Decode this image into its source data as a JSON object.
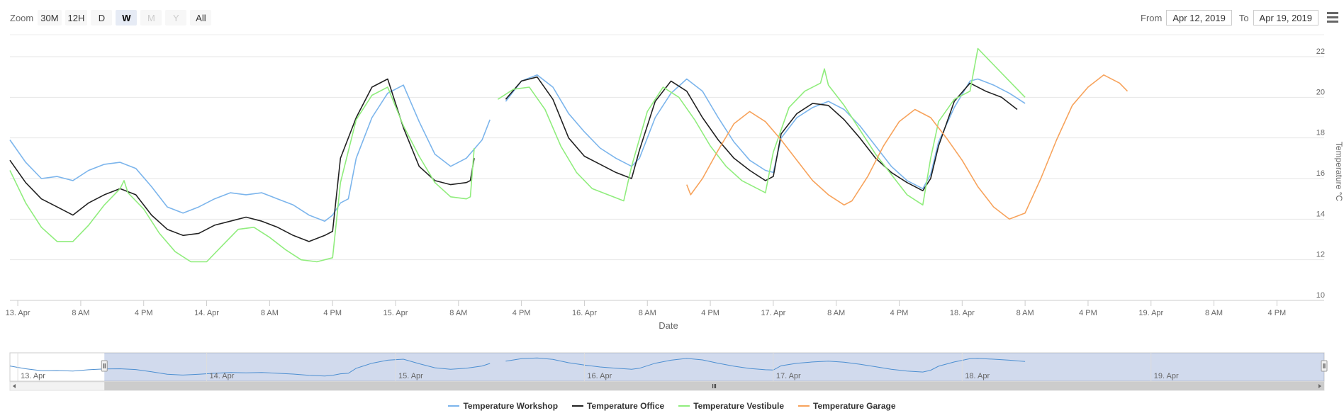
{
  "toolbar": {
    "zoom_label": "Zoom",
    "buttons": [
      {
        "label": "30M",
        "state": "normal"
      },
      {
        "label": "12H",
        "state": "normal"
      },
      {
        "label": "D",
        "state": "normal"
      },
      {
        "label": "W",
        "state": "selected"
      },
      {
        "label": "M",
        "state": "disabled"
      },
      {
        "label": "Y",
        "state": "disabled"
      },
      {
        "label": "All",
        "state": "normal"
      }
    ],
    "from_label": "From",
    "from_value": "Apr 12, 2019",
    "to_label": "To",
    "to_value": "Apr 19, 2019"
  },
  "menu_icon": "hamburger-menu-icon",
  "chart_data": {
    "type": "line",
    "xlabel": "Date",
    "ylabel": "Temperature °C",
    "ylim": [
      10,
      22
    ],
    "y_ticks": [
      "10",
      "12",
      "14",
      "16",
      "18",
      "20",
      "22"
    ],
    "x_ticks": [
      "13. Apr",
      "8 AM",
      "4 PM",
      "14. Apr",
      "8 AM",
      "4 PM",
      "15. Apr",
      "8 AM",
      "4 PM",
      "16. Apr",
      "8 AM",
      "4 PM",
      "17. Apr",
      "8 AM",
      "4 PM",
      "18. Apr",
      "8 AM",
      "4 PM",
      "19. Apr",
      "8 AM",
      "4 PM"
    ],
    "x_tick_hours": [
      24,
      32,
      40,
      48,
      56,
      64,
      72,
      80,
      88,
      96,
      104,
      112,
      120,
      128,
      136,
      144,
      152,
      160,
      168,
      176,
      184
    ],
    "x_range_hours": [
      23,
      190
    ],
    "grid": "horizontal",
    "legend_position": "bottom-center",
    "series": [
      {
        "name": "Temperature Workshop",
        "color": "#7cb5ec",
        "points": [
          [
            23,
            17.9
          ],
          [
            25,
            16.8
          ],
          [
            27,
            16.0
          ],
          [
            29,
            16.1
          ],
          [
            31,
            15.9
          ],
          [
            33,
            16.4
          ],
          [
            35,
            16.7
          ],
          [
            37,
            16.8
          ],
          [
            39,
            16.5
          ],
          [
            41,
            15.6
          ],
          [
            43,
            14.6
          ],
          [
            45,
            14.3
          ],
          [
            47,
            14.6
          ],
          [
            49,
            15.0
          ],
          [
            51,
            15.3
          ],
          [
            53,
            15.2
          ],
          [
            55,
            15.3
          ],
          [
            57,
            15.0
          ],
          [
            59,
            14.7
          ],
          [
            61,
            14.2
          ],
          [
            63,
            13.9
          ],
          [
            64,
            14.2
          ],
          [
            65,
            14.8
          ],
          [
            66,
            15.0
          ],
          [
            67,
            17.0
          ],
          [
            69,
            19.0
          ],
          [
            71,
            20.2
          ],
          [
            73,
            20.6
          ],
          [
            75,
            18.8
          ],
          [
            77,
            17.2
          ],
          [
            79,
            16.6
          ],
          [
            81,
            17.0
          ],
          [
            83,
            17.9
          ],
          [
            84,
            18.9
          ],
          [
            85,
            null
          ],
          [
            86,
            19.8
          ],
          [
            88,
            20.8
          ],
          [
            90,
            21.1
          ],
          [
            92,
            20.5
          ],
          [
            94,
            19.2
          ],
          [
            96,
            18.3
          ],
          [
            98,
            17.5
          ],
          [
            100,
            17.0
          ],
          [
            102,
            16.6
          ],
          [
            103,
            17.0
          ],
          [
            105,
            19.0
          ],
          [
            107,
            20.2
          ],
          [
            109,
            20.9
          ],
          [
            111,
            20.3
          ],
          [
            113,
            19.0
          ],
          [
            115,
            17.8
          ],
          [
            117,
            16.9
          ],
          [
            119,
            16.4
          ],
          [
            120,
            16.3
          ],
          [
            121,
            18.0
          ],
          [
            123,
            19.0
          ],
          [
            125,
            19.5
          ],
          [
            127,
            19.8
          ],
          [
            129,
            19.4
          ],
          [
            131,
            18.6
          ],
          [
            133,
            17.6
          ],
          [
            135,
            16.6
          ],
          [
            137,
            15.9
          ],
          [
            139,
            15.5
          ],
          [
            140,
            16.2
          ],
          [
            141,
            17.8
          ],
          [
            143,
            19.5
          ],
          [
            145,
            20.8
          ],
          [
            146,
            20.9
          ],
          [
            148,
            20.6
          ],
          [
            150,
            20.2
          ],
          [
            152,
            19.7
          ]
        ]
      },
      {
        "name": "Temperature Office",
        "color": "#222222",
        "points": [
          [
            23,
            16.9
          ],
          [
            25,
            15.8
          ],
          [
            27,
            15.0
          ],
          [
            29,
            14.6
          ],
          [
            31,
            14.2
          ],
          [
            33,
            14.8
          ],
          [
            35,
            15.2
          ],
          [
            37,
            15.5
          ],
          [
            39,
            15.2
          ],
          [
            41,
            14.2
          ],
          [
            43,
            13.5
          ],
          [
            45,
            13.2
          ],
          [
            47,
            13.3
          ],
          [
            49,
            13.7
          ],
          [
            51,
            13.9
          ],
          [
            53,
            14.1
          ],
          [
            55,
            13.9
          ],
          [
            57,
            13.6
          ],
          [
            59,
            13.2
          ],
          [
            61,
            12.9
          ],
          [
            63,
            13.2
          ],
          [
            64,
            13.4
          ],
          [
            65,
            17.0
          ],
          [
            67,
            19.0
          ],
          [
            69,
            20.5
          ],
          [
            71,
            20.9
          ],
          [
            73,
            18.5
          ],
          [
            75,
            16.6
          ],
          [
            77,
            15.9
          ],
          [
            79,
            15.7
          ],
          [
            81,
            15.8
          ],
          [
            81.5,
            15.9
          ],
          [
            82,
            17.0
          ],
          [
            83,
            null
          ],
          [
            86,
            19.9
          ],
          [
            88,
            20.8
          ],
          [
            90,
            21.0
          ],
          [
            92,
            19.9
          ],
          [
            94,
            18.0
          ],
          [
            96,
            17.1
          ],
          [
            98,
            16.7
          ],
          [
            100,
            16.3
          ],
          [
            102,
            16.0
          ],
          [
            103,
            17.4
          ],
          [
            105,
            19.8
          ],
          [
            107,
            20.8
          ],
          [
            109,
            20.3
          ],
          [
            111,
            19.0
          ],
          [
            113,
            17.9
          ],
          [
            115,
            17.0
          ],
          [
            117,
            16.4
          ],
          [
            119,
            15.9
          ],
          [
            120,
            16.1
          ],
          [
            121,
            18.2
          ],
          [
            123,
            19.2
          ],
          [
            125,
            19.7
          ],
          [
            127,
            19.6
          ],
          [
            129,
            18.9
          ],
          [
            131,
            18.0
          ],
          [
            133,
            17.0
          ],
          [
            135,
            16.3
          ],
          [
            137,
            15.8
          ],
          [
            139,
            15.4
          ],
          [
            140,
            16.0
          ],
          [
            141,
            17.6
          ],
          [
            143,
            19.8
          ],
          [
            145,
            20.7
          ],
          [
            147,
            20.3
          ],
          [
            149,
            20.0
          ],
          [
            151,
            19.4
          ]
        ]
      },
      {
        "name": "Temperature Vestibule",
        "color": "#90ed7d",
        "points": [
          [
            23,
            16.4
          ],
          [
            25,
            14.8
          ],
          [
            27,
            13.6
          ],
          [
            29,
            12.9
          ],
          [
            31,
            12.9
          ],
          [
            33,
            13.7
          ],
          [
            35,
            14.7
          ],
          [
            37,
            15.5
          ],
          [
            37.5,
            15.9
          ],
          [
            38,
            15.3
          ],
          [
            40,
            14.5
          ],
          [
            42,
            13.3
          ],
          [
            44,
            12.4
          ],
          [
            46,
            11.9
          ],
          [
            48,
            11.9
          ],
          [
            50,
            12.7
          ],
          [
            52,
            13.5
          ],
          [
            54,
            13.6
          ],
          [
            56,
            13.1
          ],
          [
            58,
            12.5
          ],
          [
            60,
            12.0
          ],
          [
            62,
            11.9
          ],
          [
            64,
            12.1
          ],
          [
            65,
            15.8
          ],
          [
            67,
            18.9
          ],
          [
            69,
            20.1
          ],
          [
            71,
            20.5
          ],
          [
            73,
            18.6
          ],
          [
            75,
            17.1
          ],
          [
            77,
            15.8
          ],
          [
            79,
            15.1
          ],
          [
            81,
            15.0
          ],
          [
            81.5,
            15.1
          ],
          [
            82,
            17.5
          ],
          [
            83,
            null
          ],
          [
            85,
            19.9
          ],
          [
            87,
            20.4
          ],
          [
            89,
            20.5
          ],
          [
            91,
            19.4
          ],
          [
            93,
            17.6
          ],
          [
            95,
            16.3
          ],
          [
            97,
            15.5
          ],
          [
            99,
            15.2
          ],
          [
            101,
            14.9
          ],
          [
            102,
            16.6
          ],
          [
            104,
            19.3
          ],
          [
            106,
            20.5
          ],
          [
            108,
            20.0
          ],
          [
            110,
            18.9
          ],
          [
            112,
            17.6
          ],
          [
            114,
            16.6
          ],
          [
            116,
            15.9
          ],
          [
            118,
            15.5
          ],
          [
            119,
            15.3
          ],
          [
            120,
            17.3
          ],
          [
            122,
            19.5
          ],
          [
            124,
            20.3
          ],
          [
            126,
            20.7
          ],
          [
            126.5,
            21.4
          ],
          [
            127,
            20.6
          ],
          [
            129,
            19.6
          ],
          [
            131,
            18.4
          ],
          [
            133,
            17.2
          ],
          [
            135,
            16.2
          ],
          [
            137,
            15.2
          ],
          [
            139,
            14.7
          ],
          [
            140,
            17.0
          ],
          [
            141,
            18.8
          ],
          [
            143,
            19.9
          ],
          [
            145,
            20.3
          ],
          [
            146,
            22.4
          ],
          [
            148,
            21.6
          ],
          [
            150,
            20.8
          ],
          [
            152,
            20.0
          ]
        ]
      },
      {
        "name": "Temperature Garage",
        "color": "#f7a35c",
        "points": [
          [
            109,
            15.7
          ],
          [
            109.5,
            15.2
          ],
          [
            111,
            16.0
          ],
          [
            113,
            17.4
          ],
          [
            115,
            18.7
          ],
          [
            117,
            19.3
          ],
          [
            119,
            18.8
          ],
          [
            121,
            17.9
          ],
          [
            123,
            16.9
          ],
          [
            125,
            15.9
          ],
          [
            127,
            15.2
          ],
          [
            129,
            14.7
          ],
          [
            130,
            14.9
          ],
          [
            132,
            16.1
          ],
          [
            134,
            17.6
          ],
          [
            136,
            18.8
          ],
          [
            138,
            19.4
          ],
          [
            140,
            19.0
          ],
          [
            142,
            18.0
          ],
          [
            144,
            16.9
          ],
          [
            146,
            15.6
          ],
          [
            148,
            14.6
          ],
          [
            150,
            14.0
          ],
          [
            152,
            14.3
          ],
          [
            154,
            16.0
          ],
          [
            156,
            17.9
          ],
          [
            158,
            19.6
          ],
          [
            160,
            20.5
          ],
          [
            162,
            21.1
          ],
          [
            164,
            20.7
          ],
          [
            165,
            20.3
          ]
        ]
      }
    ]
  },
  "navigator": {
    "labels": [
      "13. Apr",
      "14. Apr",
      "15. Apr",
      "16. Apr",
      "17. Apr",
      "18. Apr",
      "19. Apr"
    ],
    "label_hours": [
      24,
      48,
      72,
      96,
      120,
      144,
      168
    ],
    "selected_range_hours": [
      35,
      190
    ],
    "range_hours": [
      23,
      190
    ],
    "series": "Temperature Workshop"
  }
}
